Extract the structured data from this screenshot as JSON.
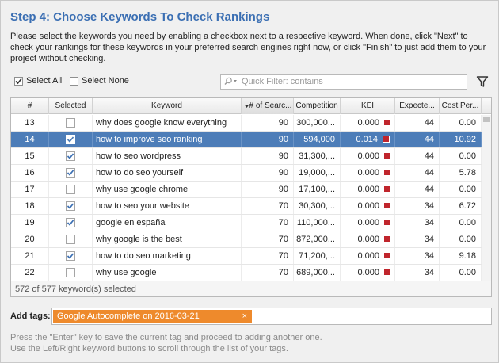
{
  "header": {
    "title": "Step 4: Choose Keywords To Check Rankings",
    "instructions": "Please select the keywords you need by enabling a checkbox next to a respective keyword. When done, click \"Next\" to check your rankings for these keywords in your preferred search engines right now, or click \"Finish\" to just add them to your project without checking."
  },
  "toolbar": {
    "select_all_label": "Select All",
    "select_all_checked": true,
    "select_none_label": "Select None",
    "filter_placeholder": "Quick Filter: contains",
    "filter_value": ""
  },
  "grid": {
    "columns": [
      "#",
      "Selected",
      "Keyword",
      "# of Searc...",
      "Competition",
      "KEI",
      "Expecte...",
      "Cost Per..."
    ],
    "rows": [
      {
        "num": "13",
        "selected": false,
        "keyword": "why does google know everything",
        "searches": "90",
        "competition": "300,000...",
        "kei": "0.000",
        "expected": "44",
        "cost": "0.00",
        "highlight": false
      },
      {
        "num": "14",
        "selected": true,
        "keyword": "how to improve seo ranking",
        "searches": "90",
        "competition": "594,000",
        "kei": "0.014",
        "expected": "44",
        "cost": "10.92",
        "highlight": true
      },
      {
        "num": "15",
        "selected": true,
        "keyword": "how to seo wordpress",
        "searches": "90",
        "competition": "31,300,...",
        "kei": "0.000",
        "expected": "44",
        "cost": "0.00",
        "highlight": false
      },
      {
        "num": "16",
        "selected": true,
        "keyword": "how to do seo yourself",
        "searches": "90",
        "competition": "19,000,...",
        "kei": "0.000",
        "expected": "44",
        "cost": "5.78",
        "highlight": false
      },
      {
        "num": "17",
        "selected": false,
        "keyword": "why use google chrome",
        "searches": "90",
        "competition": "17,100,...",
        "kei": "0.000",
        "expected": "44",
        "cost": "0.00",
        "highlight": false
      },
      {
        "num": "18",
        "selected": true,
        "keyword": "how to seo your website",
        "searches": "70",
        "competition": "30,300,...",
        "kei": "0.000",
        "expected": "34",
        "cost": "6.72",
        "highlight": false
      },
      {
        "num": "19",
        "selected": true,
        "keyword": "google en españa",
        "searches": "70",
        "competition": "110,000...",
        "kei": "0.000",
        "expected": "34",
        "cost": "0.00",
        "highlight": false
      },
      {
        "num": "20",
        "selected": false,
        "keyword": "why google is the best",
        "searches": "70",
        "competition": "872,000...",
        "kei": "0.000",
        "expected": "34",
        "cost": "0.00",
        "highlight": false
      },
      {
        "num": "21",
        "selected": true,
        "keyword": "how to do seo marketing",
        "searches": "70",
        "competition": "71,200,...",
        "kei": "0.000",
        "expected": "34",
        "cost": "9.18",
        "highlight": false
      },
      {
        "num": "22",
        "selected": false,
        "keyword": "why use google",
        "searches": "70",
        "competition": "689,000...",
        "kei": "0.000",
        "expected": "34",
        "cost": "0.00",
        "highlight": false
      }
    ],
    "footer": "572 of 577 keyword(s) selected"
  },
  "tags": {
    "label": "Add tags:",
    "items": [
      "Google Autocomplete on 2016-03-21"
    ],
    "remove_glyph": "×"
  },
  "hint": {
    "line1": "Press the \"Enter\" key to save the current tag and proceed to adding another one.",
    "line2": "Use the Left/Right keyword buttons to scroll through the list of your tags."
  },
  "colors": {
    "title": "#3b6fb3",
    "selected_row": "#4d7db8",
    "tag": "#ee8a2c",
    "kei_marker": "#c0252c"
  }
}
